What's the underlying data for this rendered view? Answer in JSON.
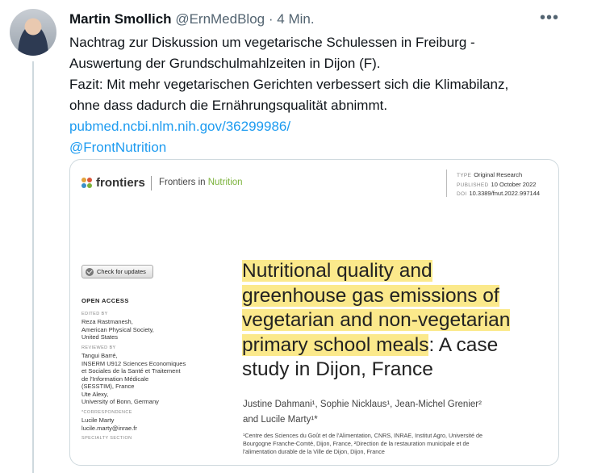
{
  "tweet": {
    "author_name": "Martin Smollich",
    "handle": "@ErnMedBlog",
    "separator": "·",
    "time": "4 Min.",
    "more_icon": "more-horizontal-icon",
    "lines": [
      "Nachtrag zur Diskussion um vegetarische Schulessen in Freiburg -",
      "Auswertung der Grundschulmahlzeiten in Dijon (F).",
      "Fazit: Mit mehr vegetarischen Gerichten verbessert sich die Klimabilanz,",
      "ohne dass dadurch die Ernährungsqualität abnimmt."
    ],
    "link": "pubmed.ncbi.nlm.nih.gov/36299986/",
    "mention": "@FrontNutrition",
    "link_color": "#1d9bf0"
  },
  "card": {
    "publisher": "frontiers",
    "journal_prefix": "Frontiers in ",
    "journal_suffix": "Nutrition",
    "meta": {
      "type_label": "TYPE",
      "type_value": "Original Research",
      "published_label": "PUBLISHED",
      "published_value": "10 October 2022",
      "doi_label": "DOI",
      "doi_value": "10.3389/fnut.2022.997144"
    },
    "check_updates": "Check for updates",
    "open_access": "OPEN ACCESS",
    "edited_by_label": "EDITED BY",
    "edited_by": "Reza Rastmanesh,\nAmerican Physical Society,\nUnited States",
    "reviewed_by_label": "REVIEWED BY",
    "reviewed_by": "Tangui Barré,\nINSERM U912 Sciences Economiques\net Sociales de la Santé et Traitement\nde l'Information Médicale\n(SESSTIM), France\nUte Alexy,\nUniversity of Bonn, Germany",
    "correspondence_label": "*CORRESPONDENCE",
    "correspondence": "Lucile Marty\nlucile.marty@inrae.fr",
    "specialty_label": "SPECIALTY SECTION",
    "title_highlighted": [
      "Nutritional quality and",
      "greenhouse gas emissions of",
      "vegetarian and non-vegetarian",
      "primary school meals"
    ],
    "title_rest_line4": ": A case",
    "title_line5": "study in Dijon, France",
    "authors": "Justine Dahmani¹,  Sophie Nicklaus¹,  Jean-Michel Grenier²\nand Lucile Marty¹*",
    "affiliations": "¹Centre des Sciences du Goût et de l'Alimentation, CNRS, INRAE, Institut Agro, Université de\nBourgogne Franche-Comté, Dijon, France, ²Direction de la restauration municipale et de\nl'alimentation durable de la Ville de Dijon, Dijon, France",
    "highlight_color": "#fbe98b",
    "journal_accent": "#7bb23b"
  }
}
